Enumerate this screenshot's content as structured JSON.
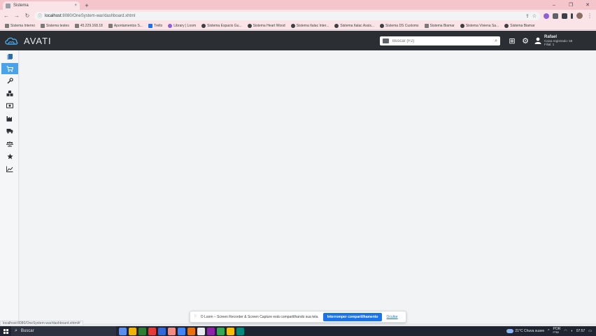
{
  "browser": {
    "tab_title": "Sistema",
    "tab_close": "×",
    "new_tab": "+",
    "window_controls": [
      "–",
      "❐",
      "✕"
    ],
    "url_host": "localhost",
    "url_path": ":8080/OneSystem-war/dashboard.xhtml",
    "status_url": "localhost:8080/OneSystem-war/dashboard.xhtml#"
  },
  "bookmarks": [
    {
      "label": "Sistema Interno",
      "icon": "folder"
    },
    {
      "label": "Sistema testes",
      "icon": "folder"
    },
    {
      "label": "45.229.168.18",
      "icon": "folder"
    },
    {
      "label": "Apontamentos S...",
      "icon": "folder"
    },
    {
      "label": "Trello",
      "icon": "blue"
    },
    {
      "label": "Library | Loom",
      "icon": "purple"
    },
    {
      "label": "Sistema Espacio Gu...",
      "icon": "globe"
    },
    {
      "label": "Sistema Heart Wood",
      "icon": "globe"
    },
    {
      "label": "Sistema Italac Inter...",
      "icon": "globe"
    },
    {
      "label": "Sistema Italac Assis...",
      "icon": "globe"
    },
    {
      "label": "Sistema DS Customs",
      "icon": "globe"
    },
    {
      "label": "Sistema Biamar",
      "icon": "folder"
    },
    {
      "label": "Sistema Viviena Sa...",
      "icon": "globe"
    },
    {
      "label": "Sistema Biamar",
      "icon": "globe"
    }
  ],
  "app": {
    "brand": "AVATI",
    "search_placeholder": "Buscar (F2)",
    "user": {
      "name": "Rafael",
      "line1": "Caixa registrado: 58",
      "line2": "Filial: 1"
    }
  },
  "share_bar": {
    "grip": "⦙⦙",
    "message": "O Loom – Screen Recorder & Screen Capture está compartilhando sua tela.",
    "stop_label": "Interromper compartilhamento",
    "hide_label": "Ocultar"
  },
  "taskbar": {
    "search_label": "Buscar",
    "weather": "21°C  Chuva suave",
    "language": "POR",
    "layout": "PTB2",
    "time": "07:57",
    "app_colors": [
      "#5b8def",
      "#f0b400",
      "#2d7d32",
      "#e53935",
      "#3367d6",
      "#f28b82",
      "#4285f4",
      "#e8710a",
      "#e8eaed",
      "#8e24aa",
      "#34a853",
      "#fbbc04",
      "#00897b"
    ]
  }
}
